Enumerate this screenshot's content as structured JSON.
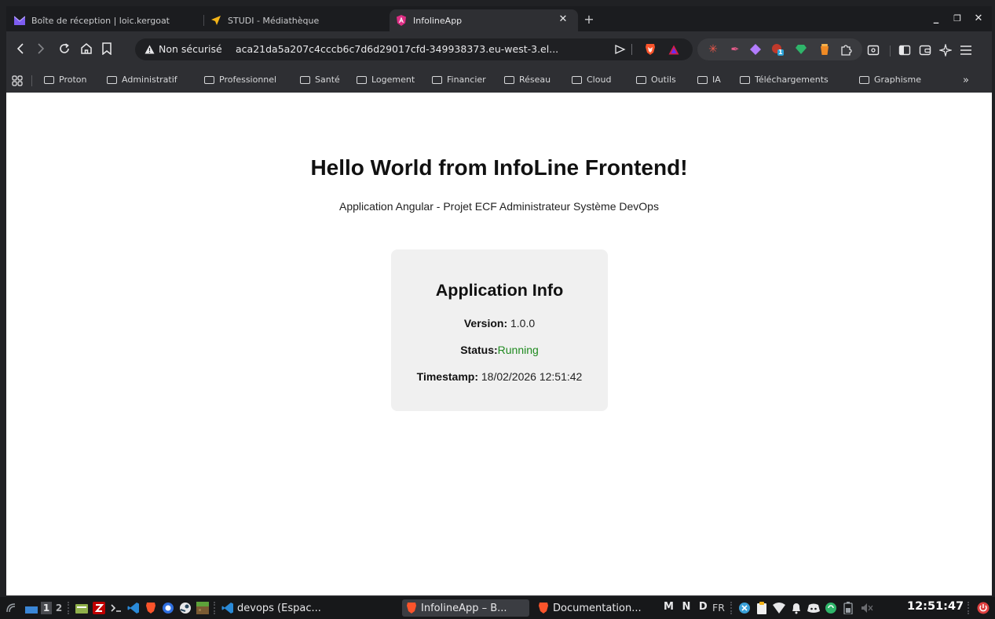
{
  "browser": {
    "tabs": [
      {
        "title": "Boîte de réception | loic.kergoat",
        "icon": "proton-mail-icon",
        "active": false
      },
      {
        "title": "STUDI - Médiathèque",
        "icon": "studi-icon",
        "active": false
      },
      {
        "title": "InfolineApp",
        "icon": "angular-icon",
        "active": true
      }
    ],
    "address_bar": {
      "security_label": "Non sécurisé",
      "url": "aca21da5a207c4cccb6c7d6d29017cfd-349938373.eu-west-3.el..."
    },
    "bookmarks": [
      "Proton",
      "Administratif",
      "Professionnel",
      "Santé",
      "Logement",
      "Financier",
      "Réseau",
      "Cloud",
      "Outils",
      "IA",
      "Téléchargements",
      "Graphisme"
    ],
    "bookmarks_overflow": "»",
    "extension_badge": "1"
  },
  "page": {
    "heading": "Hello World from InfoLine Frontend!",
    "subtitle": "Application Angular - Projet ECF Administrateur Système DevOps",
    "card": {
      "title": "Application Info",
      "version_label": "Version:",
      "version_value": "1.0.0",
      "status_label": "Status:",
      "status_value": "Running",
      "timestamp_label": "Timestamp:",
      "timestamp_value": "18/02/2026 12:51:42"
    }
  },
  "taskbar": {
    "workspaces": [
      "1",
      "2"
    ],
    "tasks": [
      {
        "label": "devops (Espac...",
        "icon": "vscode-icon",
        "active": false
      },
      {
        "label": "InfolineApp – B...",
        "icon": "brave-icon",
        "active": true
      },
      {
        "label": "Documentation...",
        "icon": "brave-icon",
        "active": false
      }
    ],
    "tray_letters": "M N D",
    "keyboard_layout": "FR",
    "clock": "12:51:47"
  },
  "colors": {
    "status_running": "#1f8a1f",
    "card_bg": "#f0f0f0",
    "brave_orange": "#fb542b"
  }
}
